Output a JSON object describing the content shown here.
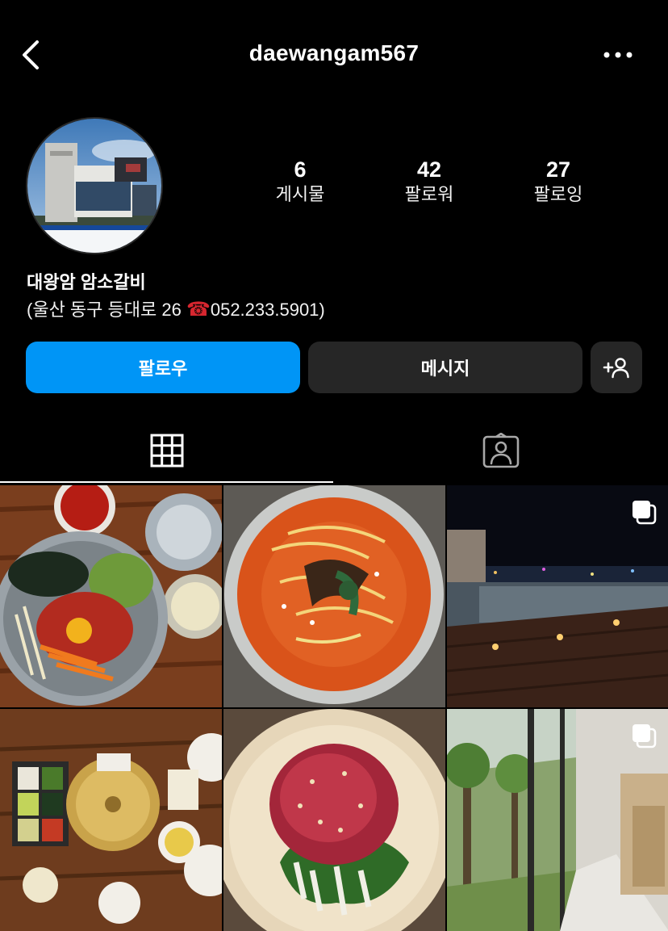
{
  "header": {
    "username": "daewangam567",
    "back_icon": "chevron-left-icon",
    "more_icon": "more-horizontal-icon"
  },
  "profile": {
    "avatar_alt": "building exterior photo",
    "stats": [
      {
        "value": "6",
        "label": "게시물"
      },
      {
        "value": "42",
        "label": "팔로워"
      },
      {
        "value": "27",
        "label": "팔로잉"
      }
    ],
    "bio_name": "대왕암 암소갈비",
    "bio_line_prefix": "(울산 동구 등대로 26 ",
    "bio_phone_emoji": "☎",
    "bio_line_suffix": "052.233.5901)"
  },
  "actions": {
    "follow_label": "팔로우",
    "message_label": "메시지",
    "add_person_icon": "add-person-icon"
  },
  "tabs": [
    {
      "name": "posts-grid",
      "icon": "grid-icon",
      "active": true
    },
    {
      "name": "tagged",
      "icon": "tagged-person-icon",
      "active": false
    }
  ],
  "posts": [
    {
      "subject": "bibimbap with yukhoe",
      "multi": false
    },
    {
      "subject": "spicy beef soup",
      "multi": false
    },
    {
      "subject": "rooftop terrace at night",
      "multi": true
    },
    {
      "subject": "table setting with grill",
      "multi": false
    },
    {
      "subject": "beef tartare on perilla leaf",
      "multi": false
    },
    {
      "subject": "glass corridor with garden",
      "multi": true
    }
  ],
  "colors": {
    "background": "#000000",
    "follow_button": "#0095f6",
    "secondary_button": "#262626"
  }
}
